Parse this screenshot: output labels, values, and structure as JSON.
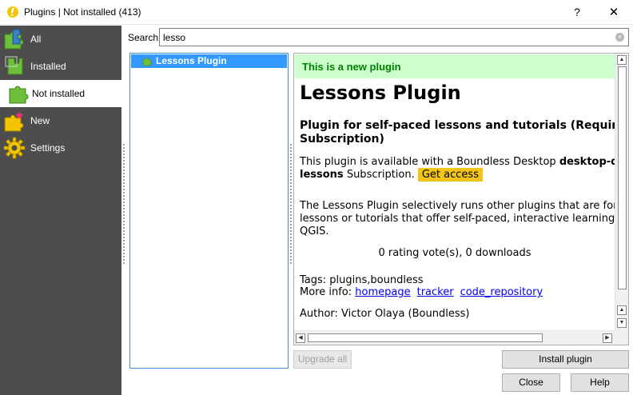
{
  "window": {
    "title": "Plugins | Not installed (413)",
    "help_glyph": "?",
    "close_glyph": "✕"
  },
  "sidebar": {
    "items": [
      {
        "label": "All",
        "icon": "puzzle-all-icon"
      },
      {
        "label": "Installed",
        "icon": "puzzle-installed-icon"
      },
      {
        "label": "Not installed",
        "icon": "puzzle-not-installed-icon",
        "active": true
      },
      {
        "label": "New",
        "icon": "puzzle-new-icon"
      },
      {
        "label": "Settings",
        "icon": "gear-icon"
      }
    ]
  },
  "search": {
    "label": "Search",
    "value": "lesso"
  },
  "plugin_list": {
    "items": [
      {
        "label": "Lessons Plugin",
        "selected": true
      }
    ]
  },
  "details": {
    "banner": "This is a new plugin",
    "title": "Lessons Plugin",
    "description_line1": "Plugin for self-paced lessons and tutorials (Require",
    "description_line2": "Subscription)",
    "avail_prefix": "This plugin is available with a Boundless Desktop ",
    "avail_bold1": "desktop-qgis",
    "avail_bold2": "lessons",
    "avail_suffix": " Subscription. ",
    "get_access": "Get access",
    "about_line1": "The Lessons Plugin selectively runs other plugins that are form",
    "about_line2": "lessons or tutorials that offer self-paced, interactive learning w",
    "about_line3": "QGIS.",
    "rating": "0 rating vote(s), 0 downloads",
    "tags": "Tags: plugins,boundless",
    "more_info_label": "More info: ",
    "link_homepage": "homepage",
    "link_tracker": "tracker",
    "link_repo": "code_repository",
    "author": "Author: Victor Olaya (Boundless)"
  },
  "buttons": {
    "upgrade_all": "Upgrade all",
    "install": "Install plugin",
    "close": "Close",
    "help": "Help"
  },
  "colors": {
    "sidebar_bg": "#4d4d4d",
    "selection": "#3399ff",
    "new_banner_bg": "#ccffcc",
    "new_banner_text": "#008000",
    "get_access_bg": "#f0c419",
    "link": "#0000ee"
  }
}
